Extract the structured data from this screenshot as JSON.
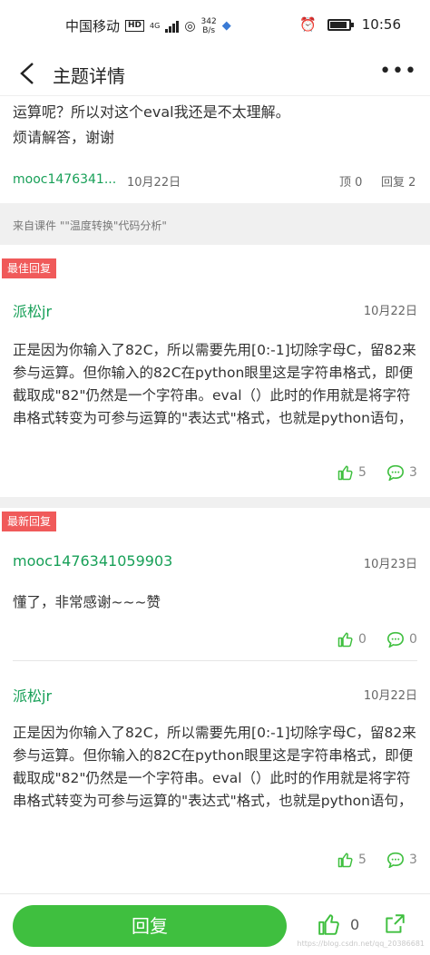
{
  "statusbar": {
    "carrier": "中国移动",
    "hd_badge": "HD",
    "network": "4G",
    "speed_value": "342",
    "speed_unit": "B/s",
    "time": "10:56"
  },
  "header": {
    "title": "主题详情",
    "back_icon": "back-chevron-icon",
    "more_icon": "more-dots-icon",
    "more_label": "•••"
  },
  "question": {
    "text_line1": "运算呢？所以对这个eval我还是不太理解。",
    "text_line2": "烦请解答，谢谢",
    "author": "mooc1476341...",
    "date": "10月22日",
    "top_label": "顶 0",
    "reply_label": "回复 2",
    "source": "来自课件 \"\"温度转换\"代码分析\""
  },
  "answers": [
    {
      "tag": "最佳回复",
      "author": "派松jr",
      "date": "10月22日",
      "text": "正是因为你输入了82C，所以需要先用[0:-1]切除字母C，留82来参与运算。但你输入的82C在python眼里这是字符串格式，即便截取成\"82\"仍然是一个字符串。eval（）此时的作用就是将字符串格式转变为可参与运算的\"表达式\"格式，也就是python语句，可参与数学...",
      "likes": "5",
      "comments": "3"
    },
    {
      "tag": "最新回复",
      "author": "mooc1476341059903",
      "date": "10月23日",
      "text": "懂了，非常感谢~~~赞",
      "likes": "0",
      "comments": "0"
    },
    {
      "tag": "",
      "author": "派松jr",
      "date": "10月22日",
      "text": "正是因为你输入了82C，所以需要先用[0:-1]切除字母C，留82来参与运算。但你输入的82C在python眼里这是字符串格式，即便截取成\"82\"仍然是一个字符串。eval（）此时的作用就是将字符串格式转变为可参与运算的\"表达式\"格式，也就是python语句，可参与数学...",
      "likes": "5",
      "comments": "3"
    }
  ],
  "bottom": {
    "reply_button": "回复",
    "like_count": "0",
    "watermark": "https://blog.csdn.net/qq_20386681"
  },
  "colors": {
    "accent_green": "#18a058",
    "reply_button_green": "#3fbf3f",
    "tag_red": "#f05a5a"
  }
}
